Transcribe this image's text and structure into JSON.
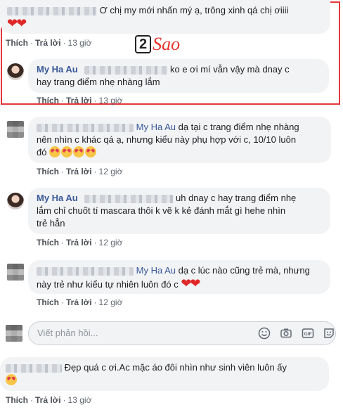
{
  "comments": [
    {
      "text": "Ơ chị my mới nhấn mý ạ, trông xinh qá chị ơiiii",
      "emoji": "❤❤",
      "actions": {
        "like": "Thích",
        "reply": "Trả lời",
        "time": "13 giờ"
      }
    },
    {
      "author": "My Ha Au",
      "text_line1": "ko e ơi mí vẫn vậy mà dnay c",
      "text_line2": "hay trang điểm nhẹ nhàng lắm",
      "actions": {
        "like": "Thích",
        "reply": "Trả lời",
        "time": "13 giờ"
      }
    },
    {
      "author": "My Ha Au",
      "text_line1": "dạ tại c trang điểm nhẹ nhàng",
      "text_line2": "nên nhìn c khác qá ạ, nhưng kiểu này phụ hợp với c, 10/10 luôn",
      "text_line3": "đó",
      "actions": {
        "like": "Thích",
        "reply": "Trả lời",
        "time": "12 giờ"
      }
    },
    {
      "author": "My Ha Au",
      "text_line1": "uh dnay c hay trang điểm nhẹ",
      "text_line2": "lắm chỉ chuốt tí mascara thôi k vẽ k kẻ đánh mắt gì hehe nhìn",
      "text_line3": "trẻ hẳn",
      "actions": {
        "like": "Thích",
        "reply": "Trả lời",
        "time": "12 giờ"
      }
    },
    {
      "author": "My Ha Au",
      "text_line1": "dạ c lúc nào cũng trẻ mà, nhưng",
      "text_line2": "này trẻ như kiểu tự nhiên luôn đó c",
      "emoji": "❤❤",
      "actions": {
        "like": "Thích",
        "reply": "Trả lời",
        "time": "12 giờ"
      }
    },
    {
      "text": "Đẹp quá c ơi.Ac mặc áo đôi nhìn như sinh viên luôn ấy",
      "actions": {
        "like": "Thích",
        "reply": "Trả lời",
        "time": "13 giờ"
      }
    }
  ],
  "reply_input": {
    "placeholder": "Viết phản hồi..."
  },
  "watermark": {
    "digit": "2",
    "word": "Sao"
  },
  "colors": {
    "highlight": "#e5373a",
    "link": "#385898",
    "bubble": "#f2f3f5",
    "heart": "#e02828"
  }
}
